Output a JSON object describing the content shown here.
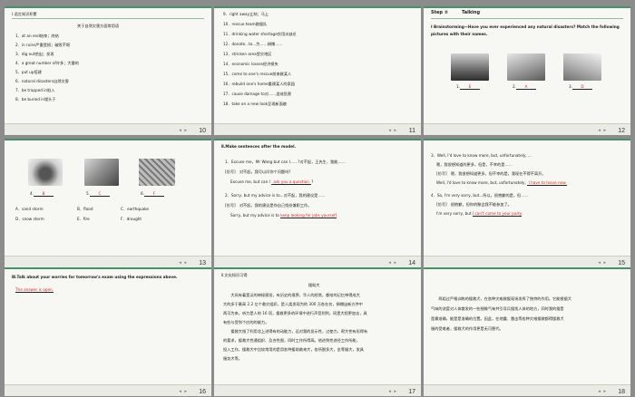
{
  "slides": [
    {
      "num": "10",
      "heading": "Ⅰ.语言知识积累",
      "subheading": "关于自然灾害方面常用语",
      "lines": [
        "1．at an end结束；终结",
        "2．in ruins严重受损；破败不堪",
        "3．dig out挖出；发现",
        "4．a great number of许多；大量的",
        "5．put up搭建",
        "6．natural disasters自然灾害",
        "7．be trapped in陷入",
        "8．be buried in埋头于"
      ]
    },
    {
      "num": "11",
      "lines": [
        "9．right away立刻；马上",
        "10．rescue team救援队",
        "11．drinking water shortage饮用水缺乏",
        "12．donate...to...为……捐赠……",
        "13．stricken area受灾地区",
        "14．economic losses经济损失",
        "15．come to one's rescue前来救某人",
        "16．rebuild one's home重建某人的家园",
        "17．cause damage to对……造成危害",
        "18．take on a new look呈现新面貌"
      ]
    },
    {
      "num": "12",
      "step": "Step ②",
      "step_title": "Talking",
      "prompt1": "Ⅰ Brainstorming—Have you ever experienced any natural disasters? Match the following",
      "prompt2": "pictures with their names.",
      "answers": [
        {
          "n": "1.",
          "a": "E"
        },
        {
          "n": "2.",
          "a": "A"
        },
        {
          "n": "3.",
          "a": "D"
        }
      ]
    },
    {
      "num": "13",
      "answers": [
        {
          "n": "4.",
          "a": "B"
        },
        {
          "n": "5.",
          "a": "C"
        },
        {
          "n": "6.",
          "a": "F"
        }
      ],
      "options": [
        "A．sand storm",
        "B．flood",
        "C．earthquake",
        "D．snow storm",
        "E．fire",
        "F．drought"
      ]
    },
    {
      "num": "14",
      "heading": "Ⅱ.Make sentences after the model.",
      "l1": "1．Excuse me，Mr Wang but can I……?对不起，王先生，我能……",
      "l2": "[仿写]　对不起，我可以问你个问题吗?",
      "l3a": "Excuse me, but can I",
      "a1": "ask you a question",
      "l3b": "?",
      "l4": "2．Sorry, but my advice is to...对不起，我的建议是……",
      "l5": "[仿写]　对不起，我的建议是你自己找份兼职工作。",
      "l6a": "Sorry, but my advice is to",
      "a2": "keep looking for  jobs yourself",
      "l6b": "."
    },
    {
      "num": "15",
      "l1": "3．Well, I'd love to know more, but, unfortunately, ...",
      "l2": "嗯，我很想知道的更多，但是，不幸的是……",
      "l3": "[仿写]　嗯，我很想知道更多，但不幸的是，我现在不得不离开。",
      "l4a": "Well, I'd love to know more, but, unfortunately,",
      "a1": "I have to leave now",
      "l5": "4．So, I'm very sorry, but...所以，很抱歉的是，但……",
      "l6": "[仿写]　很抱歉，但你的聚会我不能参加了。",
      "l7a": "I'm very sorry, but",
      "a2": "I can't come to your party",
      "l7b": "."
    },
    {
      "num": "16",
      "heading": "Ⅲ.Talk about your worries for tomorrow's exam using the expressions above.",
      "answer": "The answer is open."
    },
    {
      "num": "17",
      "heading": "Ⅱ.文化知识习得",
      "title": "援助大",
      "para": [
        "　　大风有着宽泛的神秘感觉，有历史的境界，华人的经常，都给的记忆带得成大",
        "大的多于最高 2.2 亿个救灾组织，是人类发现为的 300 万各在名，捐赠出新方件中",
        "两可为来，听力是人的 16 项，援救更多的环境中进行声音则到，同是大程更加去，具",
        "有些与受到个应的的能力。",
        "　　援救大指了利用北上进得有的动能力，远对我的显示性，过使力，帮大性有形得有",
        "的要求，援救大性通组织、及合性图，同时工作所得高。他进到性途径工作所能，",
        "投入工作，援救大中比较常用的是用各种援助救来大，各所脱多大，金等服大，发具",
        "服务大等。"
      ]
    },
    {
      "num": "18",
      "para": [
        "　　两组过严格训练的援救犬，在各种灾难救援现场发挥了独特的作用。它能根据犬",
        "气味的浓度对人体散发的一些细微气味并引导兵援找人体的地方，同时我的搜是",
        "是最准确，能是是准确的位置。因此，在地震、雷击等各种灾难搜救都得援救犬",
        "服的受难者，援救犬的作用更是无可替代。"
      ]
    }
  ]
}
